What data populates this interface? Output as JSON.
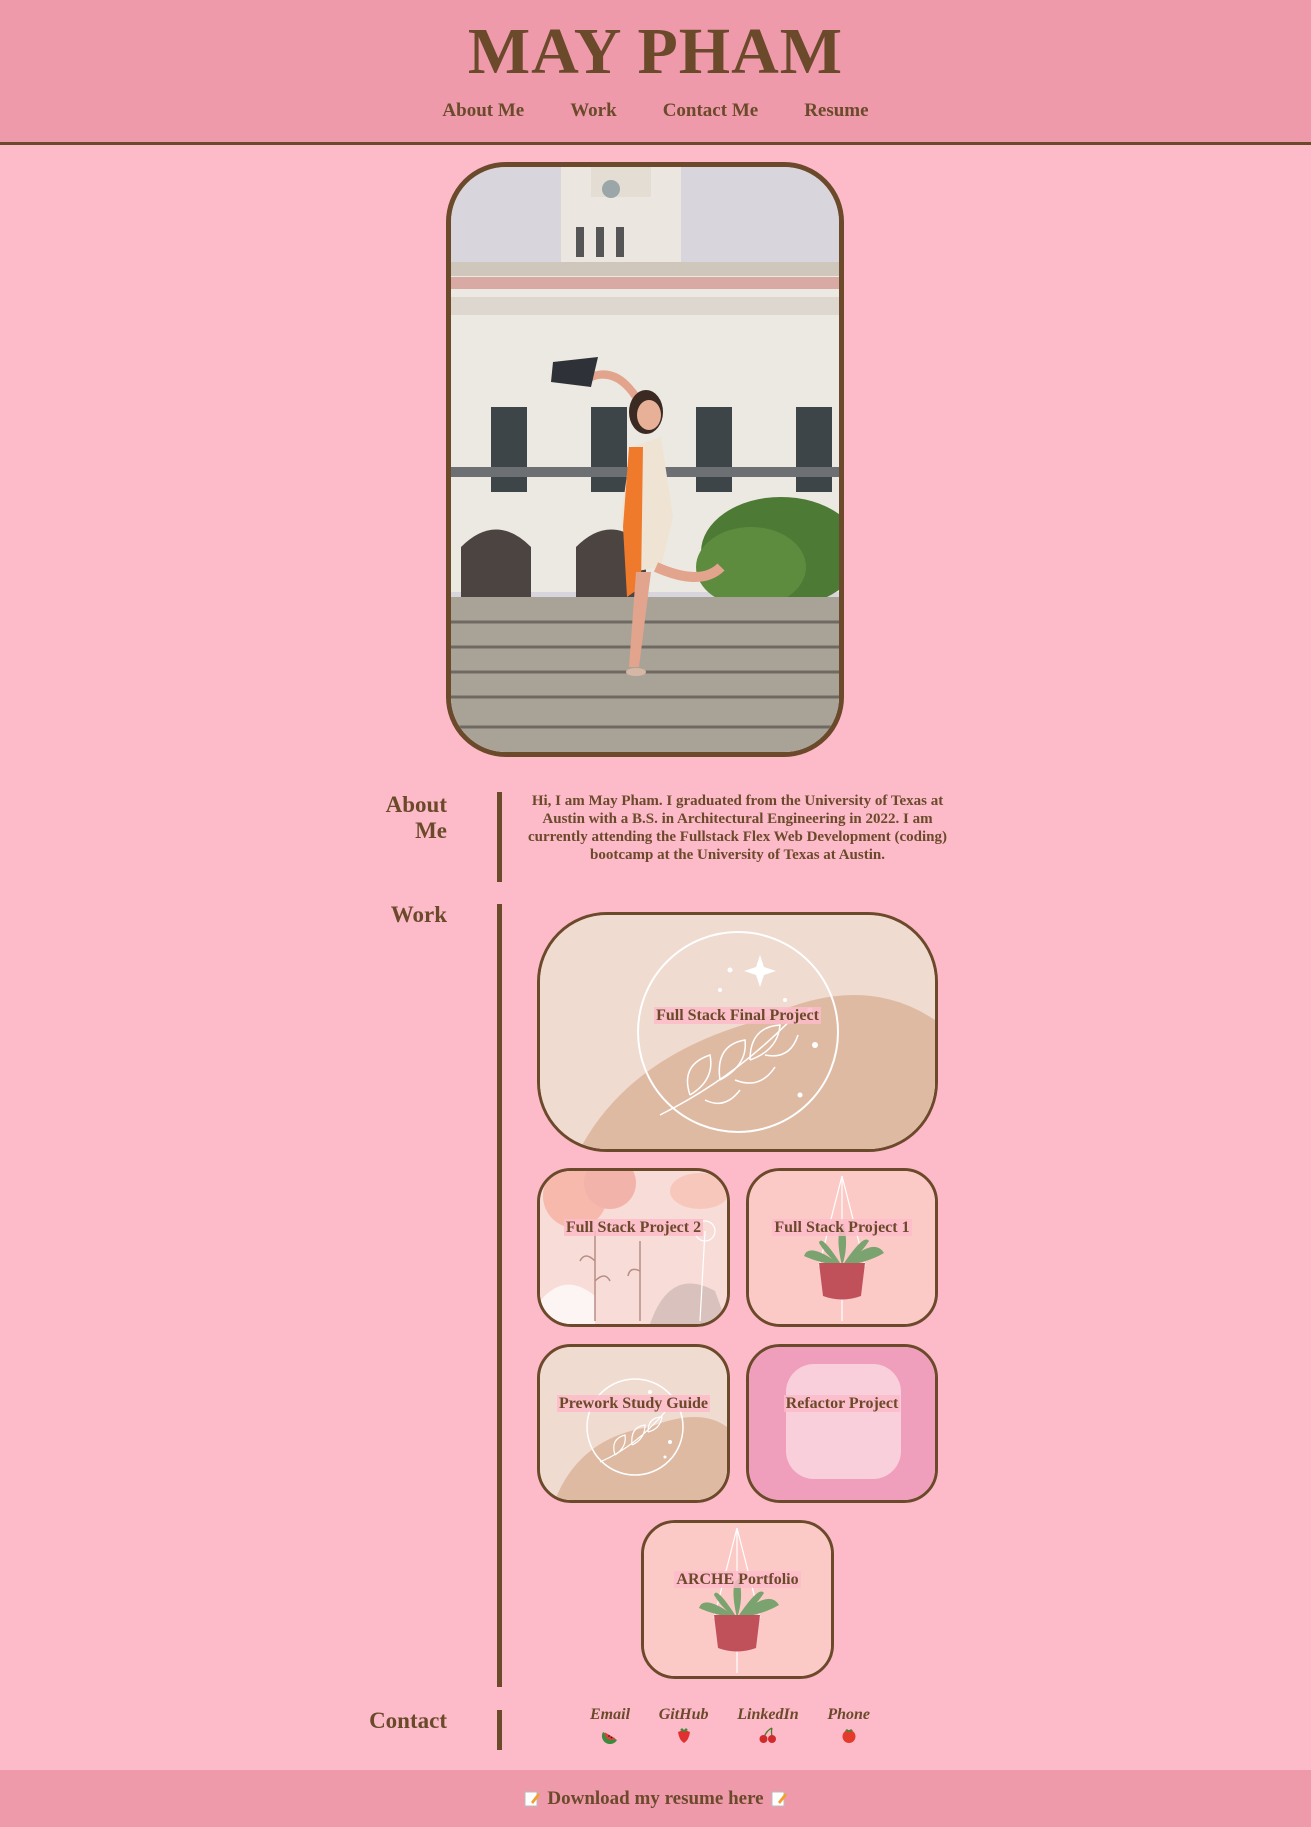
{
  "header": {
    "title": "MAY PHAM",
    "nav": [
      "About Me",
      "Work",
      "Contact Me",
      "Resume"
    ]
  },
  "about": {
    "heading_line1": "About",
    "heading_line2": "Me",
    "text": "Hi, I am May Pham. I graduated from the University of Texas at Austin with a B.S. in Architectural Engineering in 2022. I am currently attending the Fullstack Flex Web Development (coding) bootcamp at the University of Texas at Austin."
  },
  "work": {
    "heading": "Work",
    "projects": [
      "Full Stack Final Project",
      "Full Stack Project 2",
      "Full Stack Project 1",
      "Prework Study Guide",
      "Refactor Project",
      "ARCHE Portfolio"
    ]
  },
  "contact": {
    "heading": "Contact",
    "items": [
      {
        "label": "Email",
        "icon": "watermelon-icon"
      },
      {
        "label": "GitHub",
        "icon": "strawberry-icon"
      },
      {
        "label": "LinkedIn",
        "icon": "cherries-icon"
      },
      {
        "label": "Phone",
        "icon": "tomato-icon"
      }
    ]
  },
  "footer": {
    "resume_text": "Download my resume here"
  },
  "colors": {
    "background": "#fdbbc9",
    "header": "#ef9aaa",
    "text": "#6b4a2b"
  }
}
